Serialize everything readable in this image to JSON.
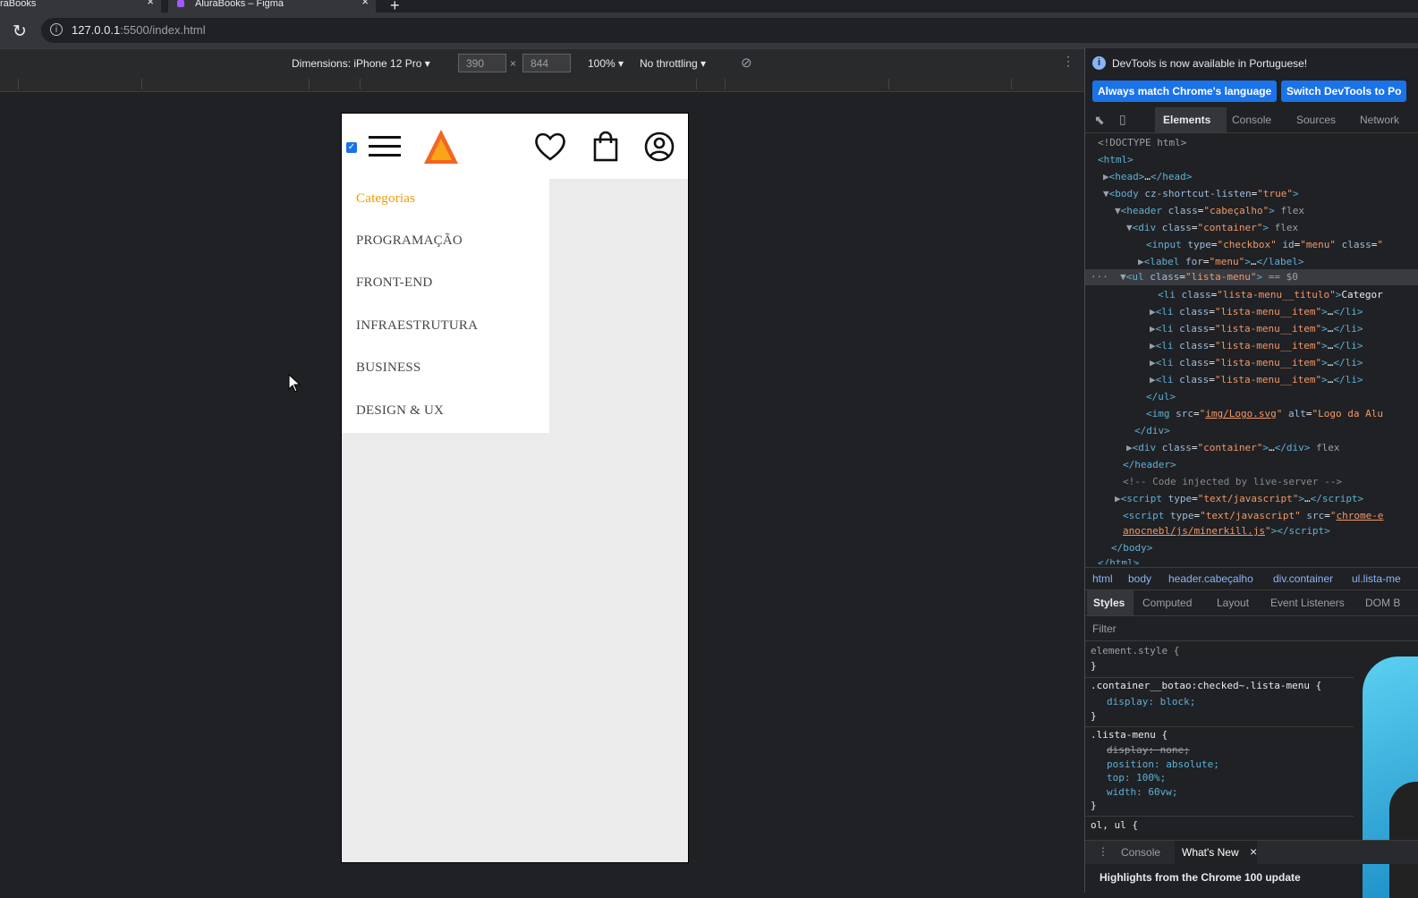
{
  "browser": {
    "tabs": [
      {
        "title": "raBooks",
        "close": "×"
      },
      {
        "title": "AluraBooks – Figma",
        "close": "×"
      }
    ],
    "new_tab": "+",
    "url_host": "127.0.0.1",
    "url_rest": ":5500/index.html"
  },
  "device_toolbar": {
    "dimensions_label": "Dimensions: iPhone 12 Pro",
    "width": "390",
    "times": "×",
    "height": "844",
    "zoom": "100%",
    "throttling": "No throttling"
  },
  "phone": {
    "menu": {
      "title": "Categorias",
      "items": [
        "PROGRAMAÇÃO",
        "FRONT-END",
        "INFRAESTRUTURA",
        "BUSINESS",
        "DESIGN & UX"
      ]
    },
    "logo_colors": {
      "outer": "#f26522",
      "inner": "#f9a51a"
    }
  },
  "devtools": {
    "info_text": "DevTools is now available in Portuguese!",
    "btn_match": "Always match Chrome's language",
    "btn_switch": "Switch DevTools to Po",
    "tabs": [
      "Elements",
      "Console",
      "Sources",
      "Network"
    ],
    "breadcrumbs": [
      "html",
      "body",
      "header.cabeçalho",
      "div.container",
      "ul.lista-me"
    ],
    "styles_tabs": [
      "Styles",
      "Computed",
      "Layout",
      "Event Listeners",
      "DOM B"
    ],
    "filter": "Filter",
    "drawer_tabs": [
      "Console",
      "What's New"
    ],
    "drawer_close": "×",
    "highlights": "Highlights from the Chrome 100 update",
    "flex_badge": "flex",
    "dollar_zero": "== $0",
    "element_style": "element.style {",
    "close_brace": "}",
    "rule1_selector": ".container__botao:checked~.lista-menu {",
    "rule1_decl": "display: block;",
    "rule2_selector": ".lista-menu {",
    "rule2_decl1": "display: none;",
    "rule2_decl2": "position: absolute;",
    "rule2_decl3": "top: 100%;",
    "rule2_decl4": "width: 60vw;",
    "rule3_selector": "ol, ul {"
  }
}
